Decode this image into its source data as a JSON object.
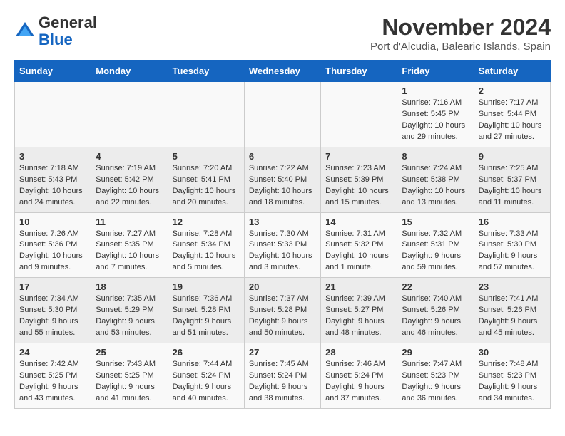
{
  "header": {
    "logo_line1": "General",
    "logo_line2": "Blue",
    "month": "November 2024",
    "location": "Port d'Alcudia, Balearic Islands, Spain"
  },
  "weekdays": [
    "Sunday",
    "Monday",
    "Tuesday",
    "Wednesday",
    "Thursday",
    "Friday",
    "Saturday"
  ],
  "weeks": [
    [
      {
        "day": "",
        "info": ""
      },
      {
        "day": "",
        "info": ""
      },
      {
        "day": "",
        "info": ""
      },
      {
        "day": "",
        "info": ""
      },
      {
        "day": "",
        "info": ""
      },
      {
        "day": "1",
        "info": "Sunrise: 7:16 AM\nSunset: 5:45 PM\nDaylight: 10 hours and 29 minutes."
      },
      {
        "day": "2",
        "info": "Sunrise: 7:17 AM\nSunset: 5:44 PM\nDaylight: 10 hours and 27 minutes."
      }
    ],
    [
      {
        "day": "3",
        "info": "Sunrise: 7:18 AM\nSunset: 5:43 PM\nDaylight: 10 hours and 24 minutes."
      },
      {
        "day": "4",
        "info": "Sunrise: 7:19 AM\nSunset: 5:42 PM\nDaylight: 10 hours and 22 minutes."
      },
      {
        "day": "5",
        "info": "Sunrise: 7:20 AM\nSunset: 5:41 PM\nDaylight: 10 hours and 20 minutes."
      },
      {
        "day": "6",
        "info": "Sunrise: 7:22 AM\nSunset: 5:40 PM\nDaylight: 10 hours and 18 minutes."
      },
      {
        "day": "7",
        "info": "Sunrise: 7:23 AM\nSunset: 5:39 PM\nDaylight: 10 hours and 15 minutes."
      },
      {
        "day": "8",
        "info": "Sunrise: 7:24 AM\nSunset: 5:38 PM\nDaylight: 10 hours and 13 minutes."
      },
      {
        "day": "9",
        "info": "Sunrise: 7:25 AM\nSunset: 5:37 PM\nDaylight: 10 hours and 11 minutes."
      }
    ],
    [
      {
        "day": "10",
        "info": "Sunrise: 7:26 AM\nSunset: 5:36 PM\nDaylight: 10 hours and 9 minutes."
      },
      {
        "day": "11",
        "info": "Sunrise: 7:27 AM\nSunset: 5:35 PM\nDaylight: 10 hours and 7 minutes."
      },
      {
        "day": "12",
        "info": "Sunrise: 7:28 AM\nSunset: 5:34 PM\nDaylight: 10 hours and 5 minutes."
      },
      {
        "day": "13",
        "info": "Sunrise: 7:30 AM\nSunset: 5:33 PM\nDaylight: 10 hours and 3 minutes."
      },
      {
        "day": "14",
        "info": "Sunrise: 7:31 AM\nSunset: 5:32 PM\nDaylight: 10 hours and 1 minute."
      },
      {
        "day": "15",
        "info": "Sunrise: 7:32 AM\nSunset: 5:31 PM\nDaylight: 9 hours and 59 minutes."
      },
      {
        "day": "16",
        "info": "Sunrise: 7:33 AM\nSunset: 5:30 PM\nDaylight: 9 hours and 57 minutes."
      }
    ],
    [
      {
        "day": "17",
        "info": "Sunrise: 7:34 AM\nSunset: 5:30 PM\nDaylight: 9 hours and 55 minutes."
      },
      {
        "day": "18",
        "info": "Sunrise: 7:35 AM\nSunset: 5:29 PM\nDaylight: 9 hours and 53 minutes."
      },
      {
        "day": "19",
        "info": "Sunrise: 7:36 AM\nSunset: 5:28 PM\nDaylight: 9 hours and 51 minutes."
      },
      {
        "day": "20",
        "info": "Sunrise: 7:37 AM\nSunset: 5:28 PM\nDaylight: 9 hours and 50 minutes."
      },
      {
        "day": "21",
        "info": "Sunrise: 7:39 AM\nSunset: 5:27 PM\nDaylight: 9 hours and 48 minutes."
      },
      {
        "day": "22",
        "info": "Sunrise: 7:40 AM\nSunset: 5:26 PM\nDaylight: 9 hours and 46 minutes."
      },
      {
        "day": "23",
        "info": "Sunrise: 7:41 AM\nSunset: 5:26 PM\nDaylight: 9 hours and 45 minutes."
      }
    ],
    [
      {
        "day": "24",
        "info": "Sunrise: 7:42 AM\nSunset: 5:25 PM\nDaylight: 9 hours and 43 minutes."
      },
      {
        "day": "25",
        "info": "Sunrise: 7:43 AM\nSunset: 5:25 PM\nDaylight: 9 hours and 41 minutes."
      },
      {
        "day": "26",
        "info": "Sunrise: 7:44 AM\nSunset: 5:24 PM\nDaylight: 9 hours and 40 minutes."
      },
      {
        "day": "27",
        "info": "Sunrise: 7:45 AM\nSunset: 5:24 PM\nDaylight: 9 hours and 38 minutes."
      },
      {
        "day": "28",
        "info": "Sunrise: 7:46 AM\nSunset: 5:24 PM\nDaylight: 9 hours and 37 minutes."
      },
      {
        "day": "29",
        "info": "Sunrise: 7:47 AM\nSunset: 5:23 PM\nDaylight: 9 hours and 36 minutes."
      },
      {
        "day": "30",
        "info": "Sunrise: 7:48 AM\nSunset: 5:23 PM\nDaylight: 9 hours and 34 minutes."
      }
    ]
  ]
}
